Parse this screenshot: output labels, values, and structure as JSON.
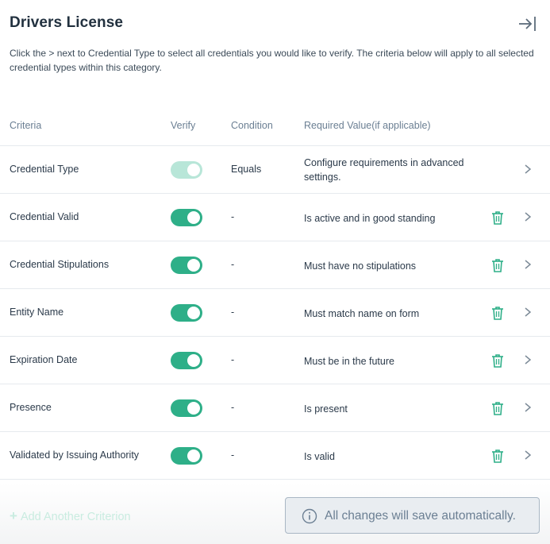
{
  "header": {
    "title": "Drivers License",
    "collapse_icon": "collapse-right-icon"
  },
  "description": "Click the > next to Credential Type to select all credentials you would like to verify. The criteria below will apply to all selected credential types within this category.",
  "table": {
    "columns": {
      "criteria": "Criteria",
      "verify": "Verify",
      "condition": "Condition",
      "required_value": "Required Value(if applicable)"
    },
    "rows": [
      {
        "criteria": "Credential Type",
        "verify_on": true,
        "verify_disabled": true,
        "condition": "Equals",
        "required_value": "Configure requirements in advanced settings.",
        "deletable": false
      },
      {
        "criteria": "Credential Valid",
        "verify_on": true,
        "verify_disabled": false,
        "condition": "-",
        "required_value": "Is active and in good standing",
        "deletable": true
      },
      {
        "criteria": "Credential Stipulations",
        "verify_on": true,
        "verify_disabled": false,
        "condition": "-",
        "required_value": "Must have no stipulations",
        "deletable": true
      },
      {
        "criteria": "Entity Name",
        "verify_on": true,
        "verify_disabled": false,
        "condition": "-",
        "required_value": "Must match name on form",
        "deletable": true
      },
      {
        "criteria": "Expiration Date",
        "verify_on": true,
        "verify_disabled": false,
        "condition": "-",
        "required_value": "Must be in the future",
        "deletable": true
      },
      {
        "criteria": "Presence",
        "verify_on": true,
        "verify_disabled": false,
        "condition": "-",
        "required_value": "Is present",
        "deletable": true
      },
      {
        "criteria": "Validated by Issuing Authority",
        "verify_on": true,
        "verify_disabled": false,
        "condition": "-",
        "required_value": "Is valid",
        "deletable": true
      }
    ]
  },
  "footer": {
    "add_plus": "+",
    "add_label": "Add Another Criterion",
    "save_message": "All changes will save automatically.",
    "info_icon": "info-icon"
  },
  "colors": {
    "accent": "#2eaf88",
    "accent_disabled": "#b8e6d8",
    "title": "#22313f",
    "muted": "#6b7f93"
  }
}
